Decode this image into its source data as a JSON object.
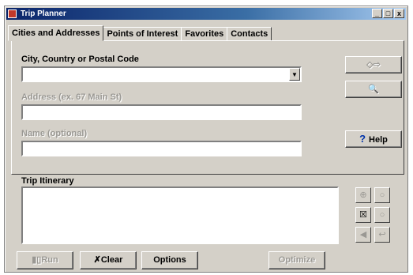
{
  "window": {
    "title": "Trip Planner",
    "controls": [
      "_",
      "□",
      "x"
    ]
  },
  "tabs": [
    {
      "label": "Cities and Addresses"
    },
    {
      "label": "Points of Interest"
    },
    {
      "label": "Favorites"
    },
    {
      "label": "Contacts"
    }
  ],
  "form": {
    "city_label": "City, Country or Postal Code",
    "city_value": "",
    "address_label": "Address (ex. 67 Main St)",
    "address_value": "",
    "name_label": "Name (optional)",
    "name_value": ""
  },
  "right_buttons": {
    "add_label": "◇⇨",
    "find_label": "🔍",
    "help_q": "?",
    "help_label": "Help"
  },
  "itinerary": {
    "label": "Trip Itinerary",
    "items": []
  },
  "side_buttons": [
    "⊕",
    "○",
    "☒",
    "○",
    "◀",
    "↩"
  ],
  "bottom_buttons": {
    "run_label": "Run",
    "clear_label": "Clear",
    "options_label": "Options",
    "optimize_label": "Optimize"
  },
  "colors": {
    "face": "#d4d0c8",
    "title_start": "#0a246a",
    "title_end": "#a6caf0",
    "disabled_text": "#9a9893"
  }
}
